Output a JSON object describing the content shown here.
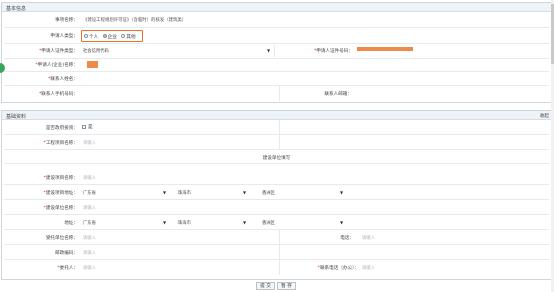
{
  "basic_info": {
    "title": "基本信息",
    "matter_label": "事项名称：",
    "matter_value": "《建设工程规划许可证》（含临时）的核发（建筑类）",
    "applicant_type_label": "申请人类型：",
    "applicant_types": [
      "个人",
      "企业",
      "其他"
    ],
    "applicant_type_selected": "企业",
    "cert_type_label": "申请人证件类型：",
    "cert_type_value": "社会信用代码",
    "cert_no_label": "申请人证件号码：",
    "applicant_name_label": "申请人(企业)名称：",
    "contact_name_label": "联系人姓名：",
    "contact_phone_label": "联系人手机号码：",
    "contact_email_label": "联系人邮箱："
  },
  "base_material": {
    "title": "基础资料",
    "collapse_label": "收起",
    "gov_invest_label": "是否政府投资：",
    "gov_invest_option": "是",
    "project_name_label": "工程项目名称：",
    "placeholder": "请输入",
    "sub_title": "建设单位填写",
    "build_project_label": "建设项目名称：",
    "build_location_label": "建设项目地址：",
    "unit_name_label": "建设单位名称：",
    "address_label": "地址：",
    "region": [
      "广东省",
      "珠海市",
      "香洲区"
    ],
    "agent_unit_label": "受托单位名称：",
    "phone_label": "电话：",
    "postcode_label": "邮政编码：",
    "client_label": "委托人：",
    "contact_tel_label": "联系电话（办公）："
  },
  "actions": {
    "submit_label": "提 交",
    "save_label": "暂 存"
  },
  "colors": {
    "highlight_border": "#e8702a",
    "redaction": "#f08a4b",
    "required": "#e02020"
  }
}
